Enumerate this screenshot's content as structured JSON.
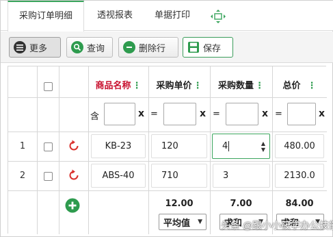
{
  "tabs": {
    "items": [
      {
        "label": "采购订单明细"
      },
      {
        "label": "透视报表"
      },
      {
        "label": "单据打印"
      }
    ],
    "move_icon": "move-icon"
  },
  "toolbar": {
    "more_label": "更多",
    "query_label": "查询",
    "delete_label": "删除行",
    "save_label": "保存"
  },
  "columns": {
    "product_name": "商品名称",
    "unit_price": "采购单价",
    "quantity": "采购数量",
    "total": "总价",
    "col_marker": "⋮"
  },
  "filters": {
    "contains_label": "含",
    "equals_label": "=",
    "clear_label": "x"
  },
  "rows": [
    {
      "num": "1",
      "name": "KB-23",
      "price": "120",
      "qty": "4",
      "total": "480.00"
    },
    {
      "num": "2",
      "name": "ABS-40",
      "price": "710",
      "qty": "3",
      "total": "2130.0"
    }
  ],
  "summary": {
    "price_value": "12.00",
    "price_func": "平均值",
    "qty_value": "7.00",
    "qty_func": "求和",
    "total_value": "84.00",
    "total_func": "求和"
  },
  "watermark": "头条 @跟小小筱学办公技能",
  "colors": {
    "accent_green": "#3aa55d",
    "header_red": "#c8102e",
    "refresh_red": "#d9302c"
  }
}
